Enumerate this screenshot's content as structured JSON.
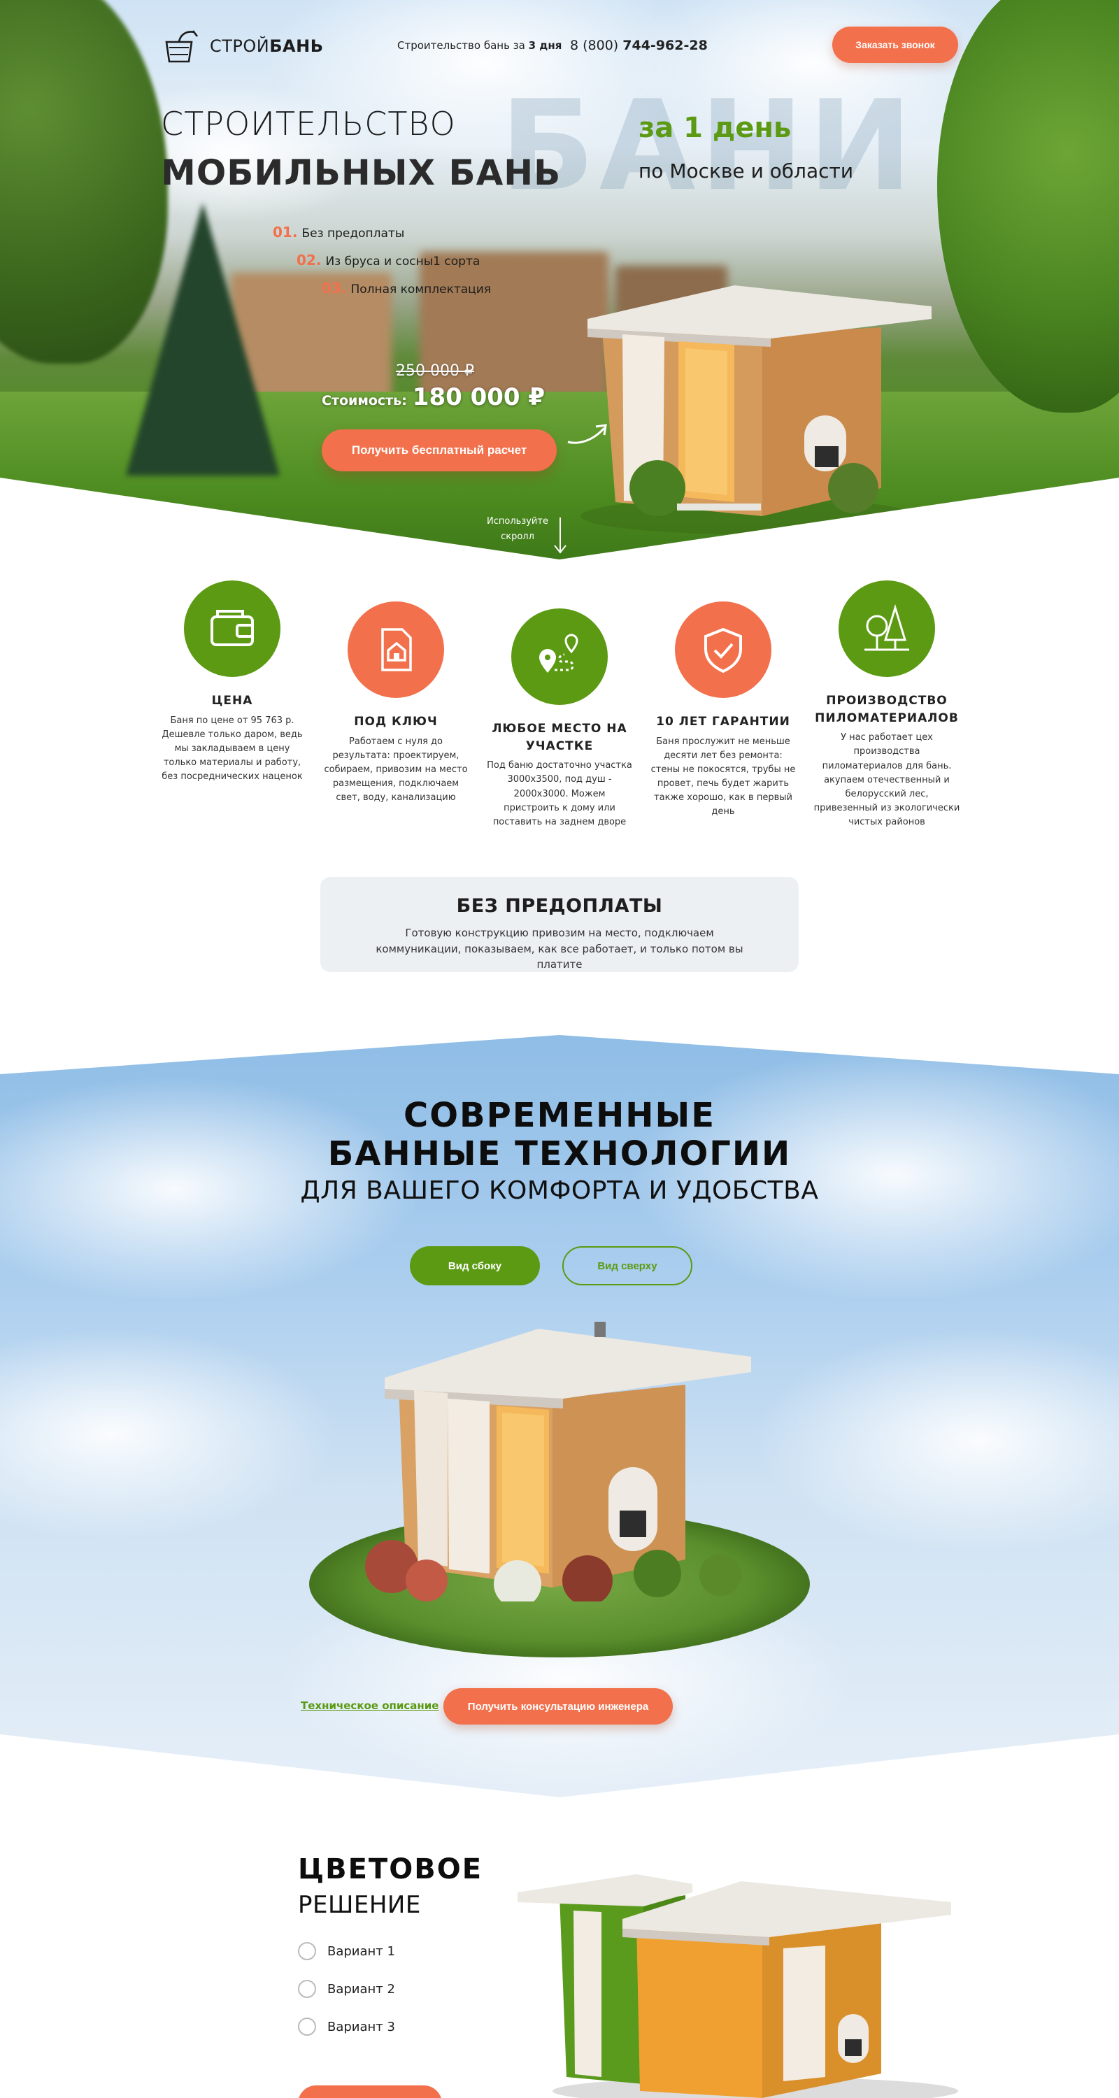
{
  "header": {
    "brand_light": "СТРОЙ",
    "brand_bold": "БАНЬ",
    "tagline_prefix": "Строительство бань за ",
    "tagline_bold": "3 дня",
    "phone_prefix": "8 (800) ",
    "phone_bold": "744-962-28",
    "call_button": "Заказать звонок"
  },
  "hero": {
    "bg_word": "БАНИ",
    "title_line1": "СТРОИТЕЛЬСТВО",
    "title_line2": "МОБИЛЬНЫХ БАНЬ",
    "green_title": "за 1 день",
    "region": "по Москве и области",
    "features": [
      {
        "num": "01.",
        "text": "Без предоплаты"
      },
      {
        "num": "02.",
        "text": "Из бруса и сосны1 сорта"
      },
      {
        "num": "03.",
        "text": "Полная комплектация"
      }
    ],
    "old_price": "250 000 ₽",
    "price_label": "Стоимость:",
    "price_value": "180 000 ₽",
    "cta_button": "Получить бесплатный расчет",
    "scroll_hint_line1": "Используйте",
    "scroll_hint_line2": "скролл"
  },
  "advantages": [
    {
      "icon": "wallet-icon",
      "title": "ЦЕНА",
      "text": "Баня по цене от 95 763 р. Дешевле только даром, ведь мы закладываем в цену только материалы и работу, без посреднических наценок"
    },
    {
      "icon": "house-document-icon",
      "title": "ПОД КЛЮЧ",
      "text": "Работаем с нуля до результата: проектируем, собираем, привозим на место размещения, подключаем свет, воду, канализацию"
    },
    {
      "icon": "map-route-icon",
      "title": "ЛЮБОЕ МЕСТО НА УЧАСТКЕ",
      "text": "Под баню достаточно участка 3000х3500, под душ - 2000х3000. Можем пристроить к дому или поставить на заднем дворе"
    },
    {
      "icon": "shield-check-icon",
      "title": "10 ЛЕТ ГАРАНТИИ",
      "text": "Баня прослужит не меньше десяти лет без ремонта: стены не покосятся, трубы не провет, печь будет жарить также хорошо, как в первый день"
    },
    {
      "icon": "trees-icon",
      "title": "ПРОИЗВОДСТВО ПИЛОМАТЕРИАЛОВ",
      "text": "У нас работает цех производства пиломатериалов для бань. акупаем отечественный и белорусский лес, привезенный из экологически чистых районов"
    }
  ],
  "no_prepay": {
    "title": "БЕЗ ПРЕДОПЛАТЫ",
    "text": "Готовую конструкцию привозим на место, подключаем коммуникации, показываем, как все работает, и только потом вы платите"
  },
  "technology": {
    "title_line1": "СОВРЕМЕННЫЕ",
    "title_line2": "БАННЫЕ ТЕХНОЛОГИИ",
    "subtitle": "ДЛЯ ВАШЕГО КОМФОРТА И УДОБСТВА",
    "tab_side": "Вид сбоку",
    "tab_top": "Вид сверху",
    "tech_link": "Техническое описание",
    "engineer_button": "Получить консультацию инженера"
  },
  "color_section": {
    "title_line1": "ЦВЕТОВОЕ",
    "title_line2": "РЕШЕНИЕ",
    "options": [
      "Вариант 1",
      "Вариант 2",
      "Вариант 3"
    ]
  },
  "colors": {
    "accent_orange": "#f2704b",
    "accent_green": "#5b9a12"
  }
}
